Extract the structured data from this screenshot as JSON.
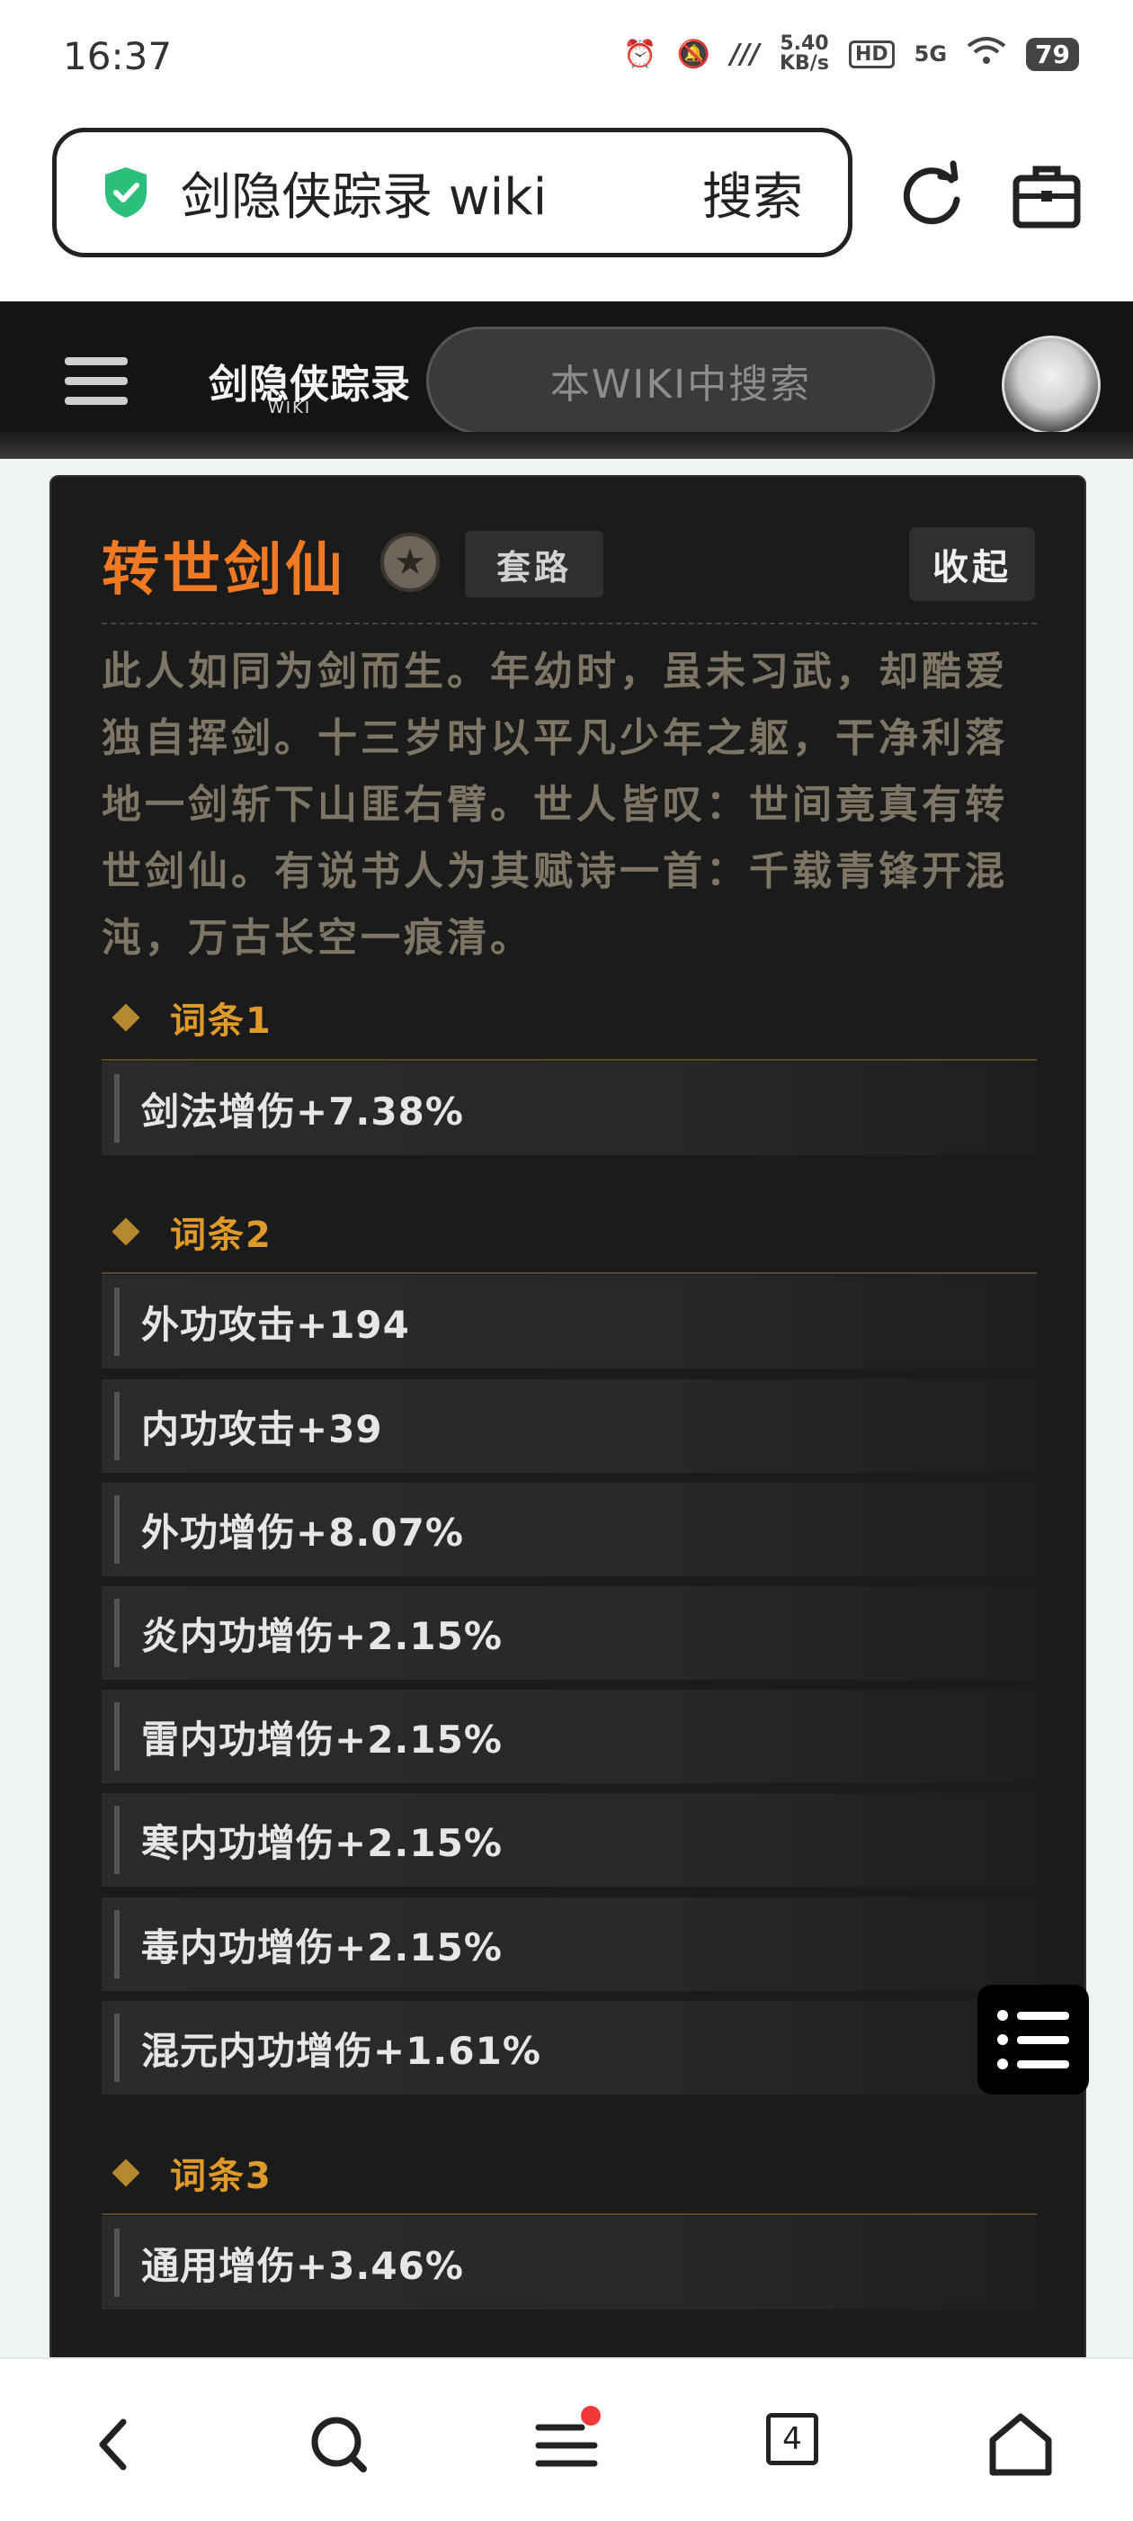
{
  "status": {
    "time": "16:37",
    "net_speed_value": "5.40",
    "net_speed_unit": "KB/s",
    "hd": "HD",
    "signal": "5G",
    "battery": "79"
  },
  "browser": {
    "url_text": "剑隐侠踪录 wiki",
    "search_label": "搜索",
    "shield_color": "#2bbf7a"
  },
  "wiki": {
    "logo_text": "剑隐侠踪录",
    "logo_sub": "WIKI",
    "search_placeholder": "本WIKI中搜索"
  },
  "card": {
    "title": "转世剑仙",
    "tag": "套路",
    "collapse_label": "收起",
    "description": "此人如同为剑而生。年幼时，虽未习武，却酷爱独自挥剑。十三岁时以平凡少年之躯，干净利落地一剑斩下山匪右臂。世人皆叹：世间竟真有转世剑仙。有说书人为其赋诗一首：千载青锋开混沌，万古长空一痕清。",
    "sections": [
      {
        "label": "词条1",
        "items": [
          "剑法增伤+7.38%"
        ]
      },
      {
        "label": "词条2",
        "items": [
          "外功攻击+194",
          "内功攻击+39",
          "外功增伤+8.07%",
          "炎内功增伤+2.15%",
          "雷内功增伤+2.15%",
          "寒内功增伤+2.15%",
          "毒内功增伤+2.15%",
          "混元内功增伤+1.61%"
        ]
      },
      {
        "label": "词条3",
        "items": [
          "通用增伤+3.46%"
        ]
      }
    ]
  },
  "bottom_nav": {
    "tab_count": "4"
  },
  "colors": {
    "title_orange": "#ef7a23",
    "section_gold": "#e09a2a",
    "card_bg": "#1b1b1b"
  }
}
